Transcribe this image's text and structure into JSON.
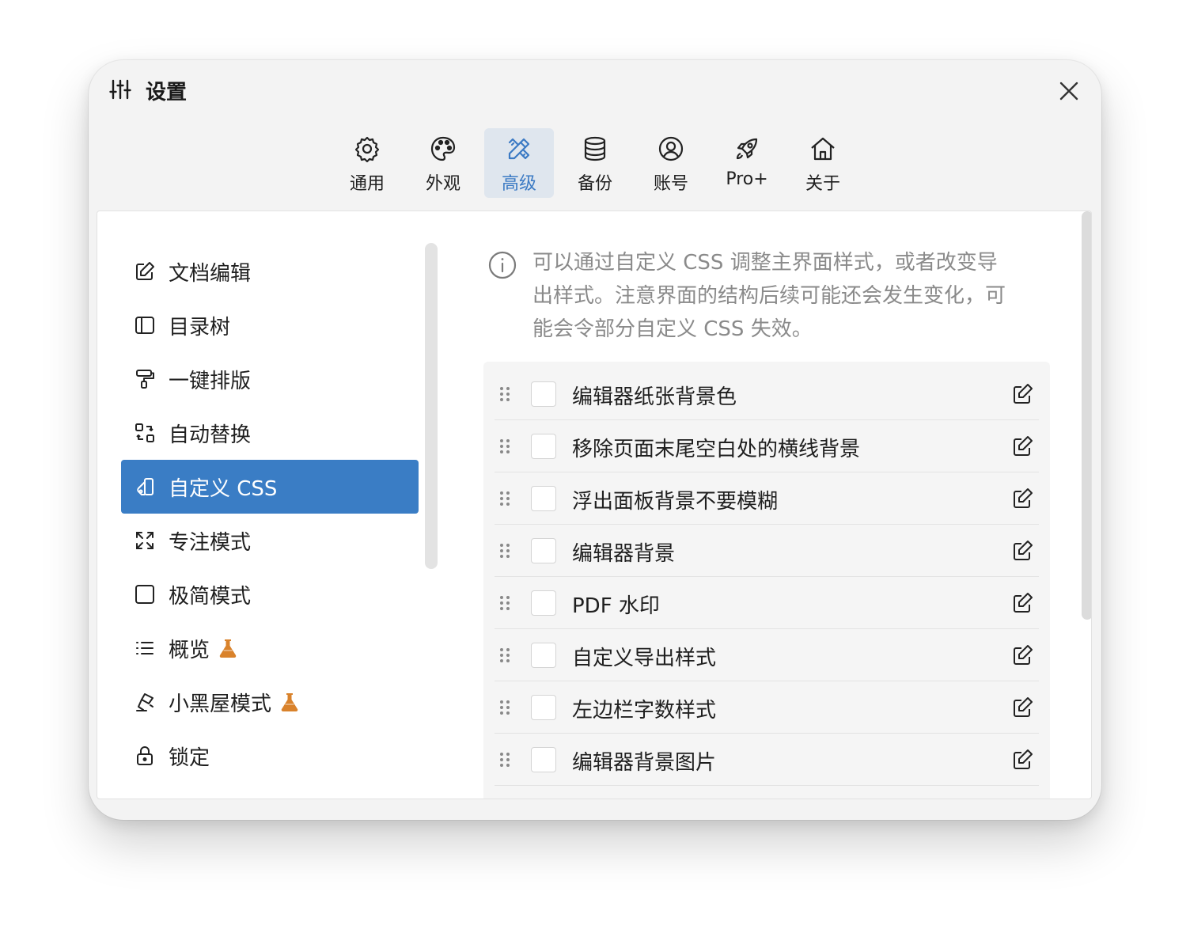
{
  "window": {
    "title": "设置"
  },
  "tabs": [
    {
      "label": "通用",
      "icon": "gear-icon"
    },
    {
      "label": "外观",
      "icon": "palette-icon"
    },
    {
      "label": "高级",
      "icon": "tools-icon",
      "active": true
    },
    {
      "label": "备份",
      "icon": "database-icon"
    },
    {
      "label": "账号",
      "icon": "user-circle-icon"
    },
    {
      "label": "Pro+",
      "icon": "rocket-icon"
    },
    {
      "label": "关于",
      "icon": "home-icon"
    }
  ],
  "sidebar": {
    "items": [
      {
        "label": "文档编辑",
        "icon": "edit-icon"
      },
      {
        "label": "目录树",
        "icon": "sidebar-layout-icon"
      },
      {
        "label": "一键排版",
        "icon": "paint-roller-icon"
      },
      {
        "label": "自动替换",
        "icon": "replace-icon"
      },
      {
        "label": "自定义 CSS",
        "icon": "css-shapes-icon",
        "active": true
      },
      {
        "label": "专注模式",
        "icon": "expand-icon"
      },
      {
        "label": "极简模式",
        "icon": "square-icon"
      },
      {
        "label": "概览",
        "icon": "list-icon",
        "experimental": true
      },
      {
        "label": "小黑屋模式",
        "icon": "lamp-icon",
        "experimental": true
      },
      {
        "label": "锁定",
        "icon": "lock-icon"
      }
    ]
  },
  "info": {
    "line1": "可以通过自定义 CSS 调整主界面样式，或者改变导",
    "line2": "出样式。注意界面的结构后续可能还会发生变化，可",
    "line3": "能会令部分自定义 CSS 失效。"
  },
  "css_list": [
    {
      "label": "编辑器纸张背景色",
      "checked": false
    },
    {
      "label": "移除页面末尾空白处的横线背景",
      "checked": false
    },
    {
      "label": "浮出面板背景不要模糊",
      "checked": false
    },
    {
      "label": "编辑器背景",
      "checked": false
    },
    {
      "label": "PDF 水印",
      "checked": false
    },
    {
      "label": "自定义导出样式",
      "checked": false
    },
    {
      "label": "左边栏字数样式",
      "checked": false
    },
    {
      "label": "编辑器背景图片",
      "checked": false
    }
  ],
  "colors": {
    "accent": "#3a7dc5",
    "flask": "#d9822b",
    "muted_text": "#8a8a8a"
  }
}
